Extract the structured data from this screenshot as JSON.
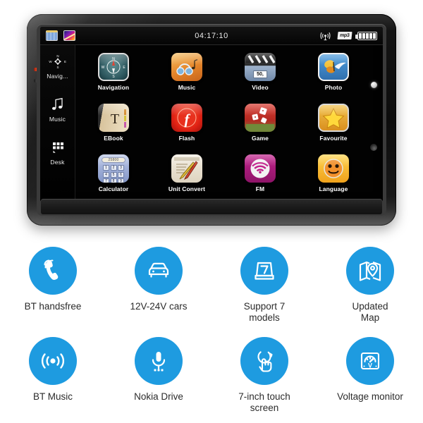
{
  "colors": {
    "feature_blue": "#1E9BE0",
    "device_body": "#111111",
    "screen_bg": "#020202",
    "label_text": "#2b2b2b"
  },
  "device": {
    "statusbar": {
      "clock": "04:17:10",
      "left_tiles": [
        {
          "name": "grid-tile-icon",
          "label": "grid"
        },
        {
          "name": "gradient-tile-icon",
          "label": "gradient"
        }
      ],
      "right_icons": [
        {
          "name": "wireless-signal-icon",
          "label": "signal"
        },
        {
          "name": "mp3-badge-icon",
          "label": "mp3"
        },
        {
          "name": "battery-icon",
          "label": "battery",
          "bars": 5
        }
      ]
    },
    "sidebar": [
      {
        "icon": "compass-icon",
        "label": "Navig..."
      },
      {
        "icon": "music-note-icon",
        "label": "Music"
      },
      {
        "icon": "desk-grid-icon",
        "label": "Desk"
      }
    ],
    "apps": [
      {
        "icon": "compass-app-icon",
        "label": "Navigation"
      },
      {
        "icon": "headphones-app-icon",
        "label": "Music"
      },
      {
        "icon": "clapperboard-app-icon",
        "label": "Video",
        "badge": "50,"
      },
      {
        "icon": "butterfly-photo-app-icon",
        "label": "Photo"
      },
      {
        "icon": "book-app-icon",
        "label": "EBook"
      },
      {
        "icon": "flash-app-icon",
        "label": "Flash"
      },
      {
        "icon": "dice-game-app-icon",
        "label": "Game"
      },
      {
        "icon": "star-favourite-app-icon",
        "label": "Favourite"
      },
      {
        "icon": "calculator-app-icon",
        "label": "Calculator",
        "display": "25800"
      },
      {
        "icon": "unit-convert-app-icon",
        "label": "Unit Convert"
      },
      {
        "icon": "fm-radio-app-icon",
        "label": "FM"
      },
      {
        "icon": "smiley-language-app-icon",
        "label": "Language"
      }
    ],
    "calculator_keys": [
      "1",
      "2",
      "3",
      "4",
      "5",
      "6",
      "7",
      "8",
      "9"
    ]
  },
  "features": [
    {
      "icon": "phone-handsfree-icon",
      "label": "BT handsfree"
    },
    {
      "icon": "car-icon",
      "label": "12V-24V cars"
    },
    {
      "icon": "seven-models-icon",
      "label": "Support 7\nmodels"
    },
    {
      "icon": "map-pin-icon",
      "label": "Updated\nMap"
    },
    {
      "icon": "bt-music-waves-icon",
      "label": "BT Music"
    },
    {
      "icon": "microphone-icon",
      "label": "Nokia Drive"
    },
    {
      "icon": "touch-hand-icon",
      "label": "7-inch touch\nscreen"
    },
    {
      "icon": "voltmeter-icon",
      "label": "Voltage monitor"
    }
  ]
}
